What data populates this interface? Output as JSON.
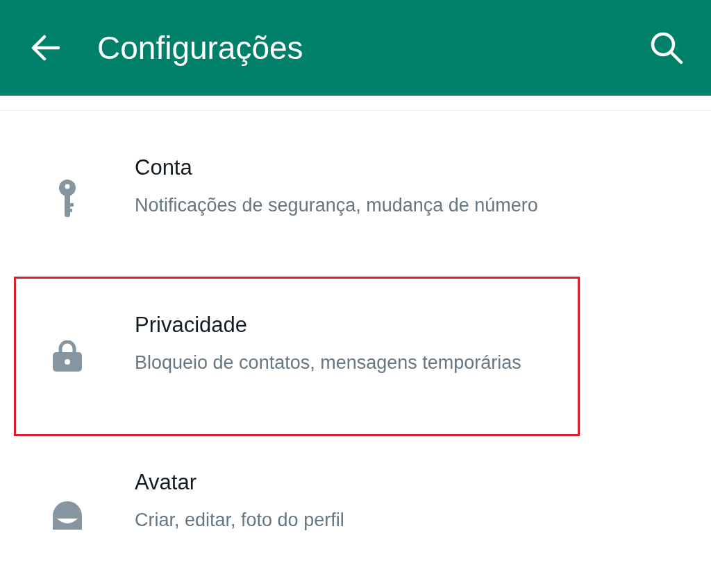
{
  "header": {
    "title": "Configurações"
  },
  "items": [
    {
      "kind": "key",
      "title": "Conta",
      "subtitle": "Notificações de segurança, mudança de número",
      "highlighted": false
    },
    {
      "kind": "lock",
      "title": "Privacidade",
      "subtitle": "Bloqueio de contatos, mensagens temporárias",
      "highlighted": true
    },
    {
      "kind": "avatar",
      "title": "Avatar",
      "subtitle": "Criar, editar, foto do perfil",
      "highlighted": false
    }
  ]
}
